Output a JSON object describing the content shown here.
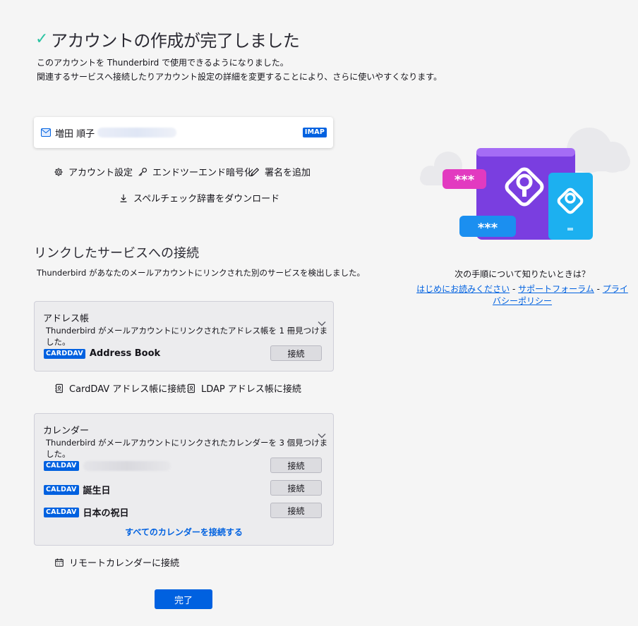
{
  "header": {
    "title": "アカウントの作成が完了しました",
    "desc_line1": "このアカウントを Thunderbird で使用できるようになりました。",
    "desc_line2": "関連するサービスへ接続したりアカウント設定の詳細を変更することにより、さらに使いやすくなります。"
  },
  "account": {
    "name": "増田 順子",
    "protocol": "IMAP"
  },
  "actions": {
    "settings": "アカウント設定",
    "e2e": "エンドツーエンド暗号化",
    "signature": "署名を追加",
    "spellcheck": "スペルチェック辞書をダウンロード"
  },
  "linked": {
    "title": "リンクしたサービスへの接続",
    "desc": "Thunderbird があなたのメールアカウントにリンクされた別のサービスを検出しました。"
  },
  "addressbook": {
    "title": "アドレス帳",
    "desc": "Thunderbird がメールアカウントにリンクされたアドレス帳を 1 冊見つけました。",
    "items": [
      {
        "badge": "CARDDAV",
        "name": "Address Book",
        "button": "接続"
      }
    ],
    "connect_carddav": "CardDAV アドレス帳に接続",
    "connect_ldap": "LDAP アドレス帳に接続"
  },
  "calendar": {
    "title": "カレンダー",
    "desc": "Thunderbird がメールアカウントにリンクされたカレンダーを 3 個見つけました。",
    "items": [
      {
        "badge": "CALDAV",
        "name": "",
        "button": "接続"
      },
      {
        "badge": "CALDAV",
        "name": "誕生日",
        "button": "接続"
      },
      {
        "badge": "CALDAV",
        "name": "日本の祝日",
        "button": "接続"
      }
    ],
    "connect_all": "すべてのカレンダーを接続する",
    "connect_remote": "リモートカレンダーに接続"
  },
  "done_button": "完了",
  "help": {
    "question": "次の手順について知りたいときは？",
    "link1": "はじめにお読みください",
    "link2": "サポートフォーラム",
    "link3": "プライバシーポリシー",
    "separator": "-"
  },
  "illustration": {
    "password_mask": "***"
  },
  "colors": {
    "accent": "#0061e0",
    "check": "#2ac3a2"
  }
}
